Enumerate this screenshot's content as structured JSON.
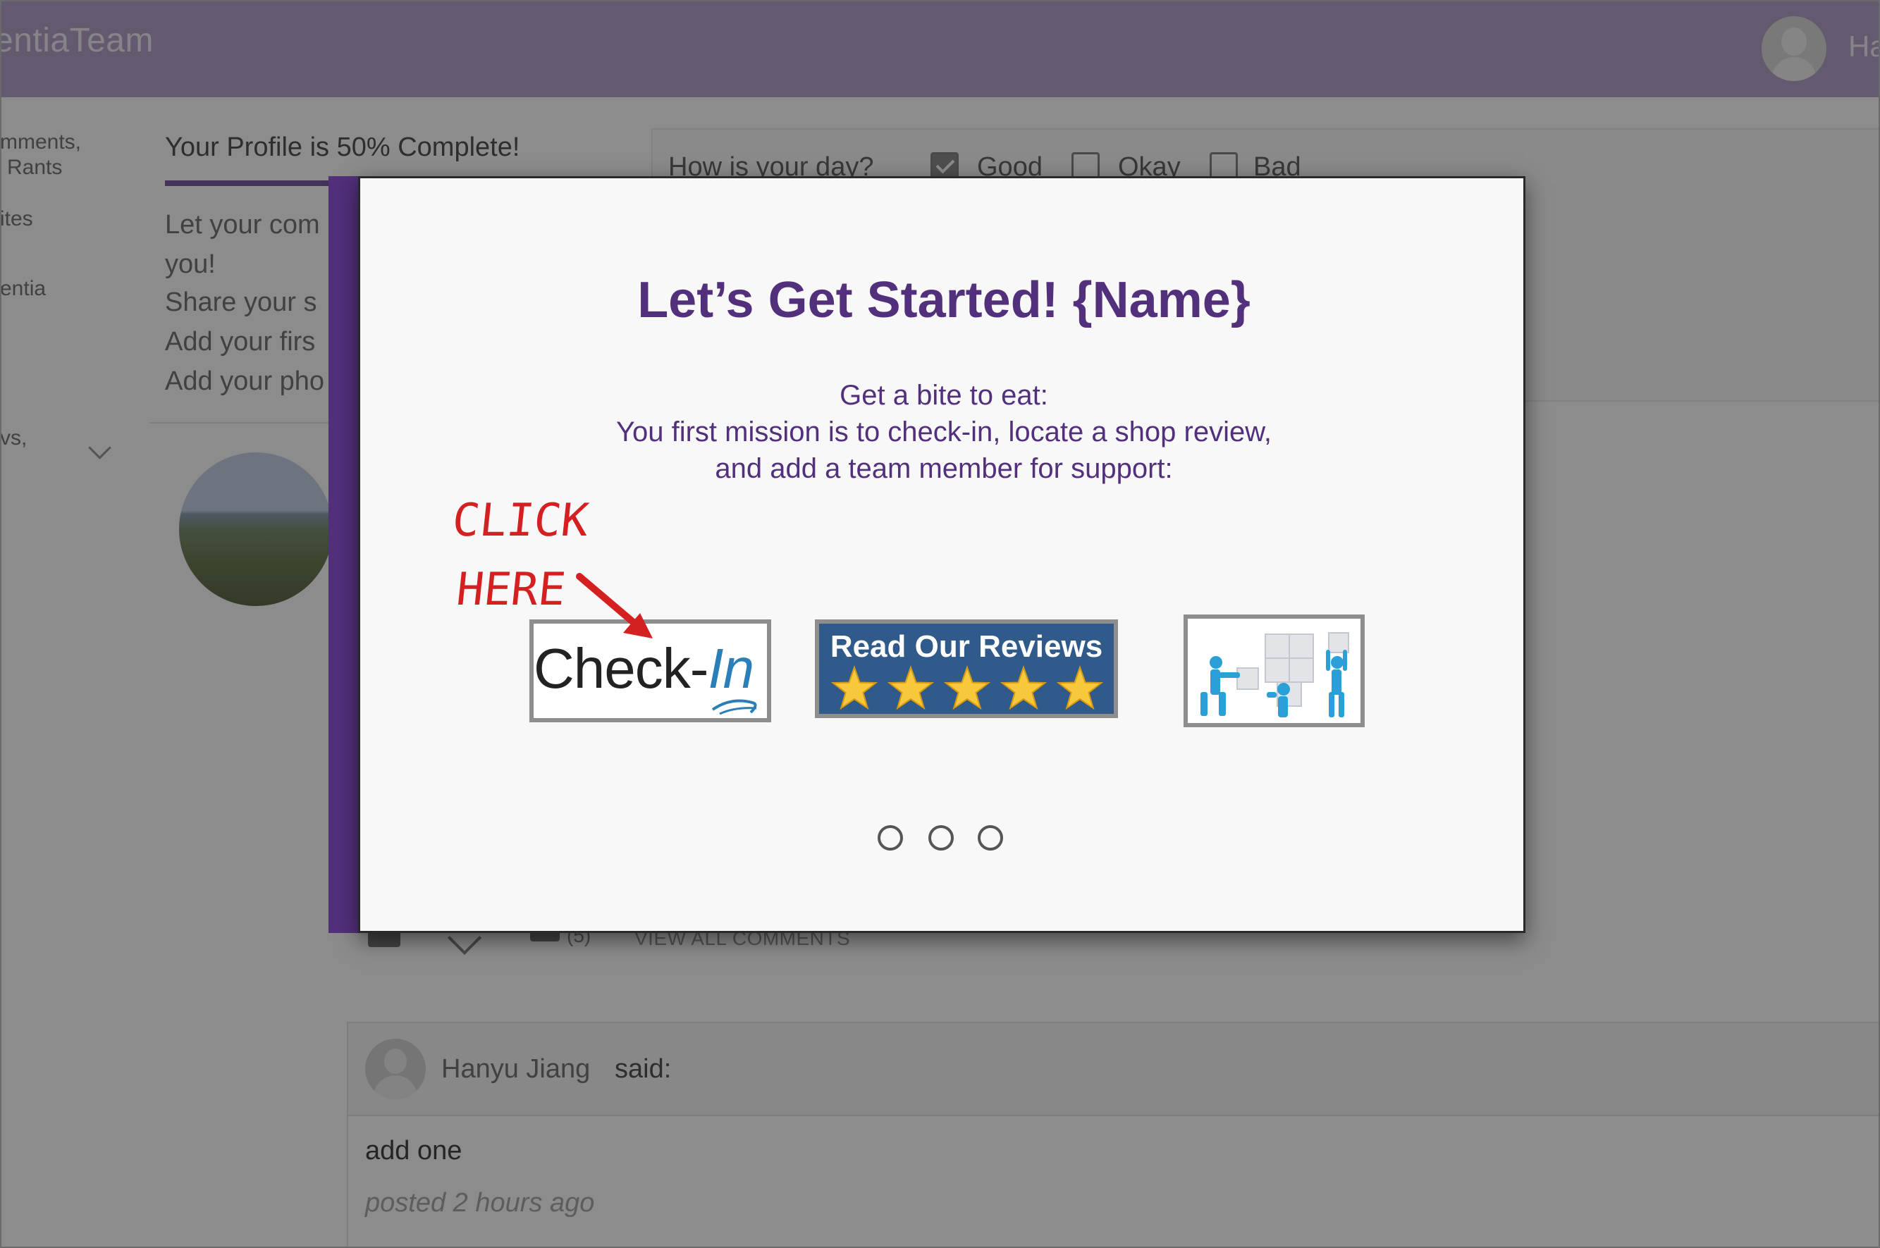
{
  "app": {
    "brand": "entiaTeam",
    "user_name_partial": "Ha"
  },
  "sidebar": {
    "items": [
      {
        "label": "mments,"
      },
      {
        "label": "Rants"
      },
      {
        "label": "ites"
      },
      {
        "label": "entia"
      },
      {
        "label": "vs,"
      }
    ]
  },
  "profile": {
    "title": "Your Profile is 50% Complete!",
    "completion": 0.5,
    "lines": [
      "Let your com",
      "you!",
      "Share your s",
      "Add your firs",
      "Add your pho"
    ]
  },
  "mood": {
    "question": "How is your day?",
    "options": [
      {
        "label": "Good",
        "checked": true
      },
      {
        "label": "Okay",
        "checked": false
      },
      {
        "label": "Bad",
        "checked": false
      }
    ]
  },
  "post": {
    "comment_count": "(5)",
    "view_all_label": "VIEW ALL COMMENTS"
  },
  "comment": {
    "author": "Hanyu Jiang",
    "said": "said:",
    "text": "add one",
    "time": "posted 2 hours ago"
  },
  "modal": {
    "title": "Let’s Get Started! {Name}",
    "line1": "Get a bite to eat:",
    "line2": "You first mission is to check-in, locate a shop review,",
    "line3": "and add a team member for support:",
    "checkin": {
      "prefix": "Check-",
      "suffix": "In"
    },
    "reviews": {
      "label": "Read Our Reviews",
      "stars": 5
    },
    "team_icon": "team-puzzle-icon",
    "pages": 3,
    "accent_color": "#52307c"
  },
  "annotation": {
    "line1": "CLICK",
    "line2": "HERE",
    "color": "#d42020"
  }
}
